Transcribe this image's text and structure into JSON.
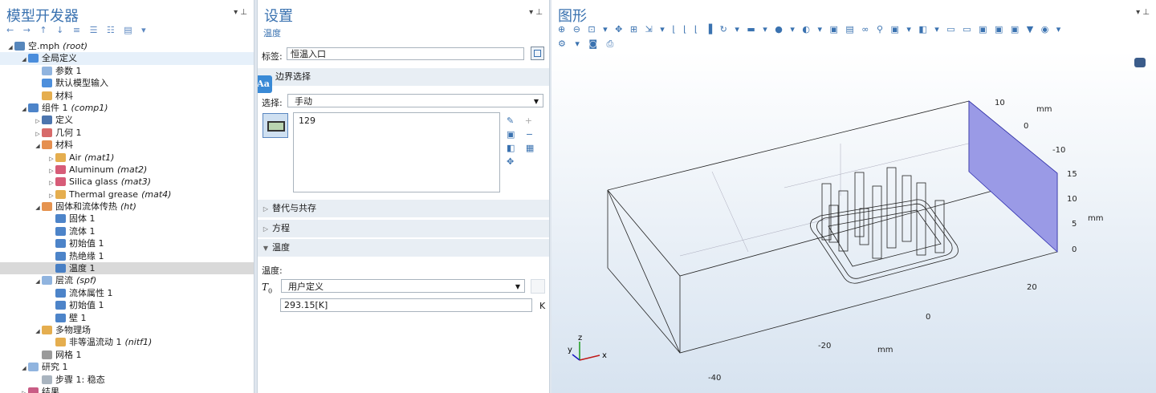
{
  "model_builder": {
    "title": "模型开发器",
    "toolbar": "← → ↑ ↓ ≡ ☰ ☷ ▤ ▾",
    "tree": [
      {
        "indent": 0,
        "tw": "◢",
        "icon": "#3a72b0",
        "label": "空.mph",
        "tag": "(root)"
      },
      {
        "indent": 1,
        "tw": "◢",
        "icon": "#2e7bd6",
        "label": "全局定义",
        "tag": "",
        "hl": true
      },
      {
        "indent": 2,
        "tw": "",
        "icon": "#7da7d9",
        "label": "参数 1",
        "tag": ""
      },
      {
        "indent": 2,
        "tw": "",
        "icon": "#2e7bd6",
        "label": "默认模型输入",
        "tag": ""
      },
      {
        "indent": 2,
        "tw": "",
        "icon": "#e0a030",
        "label": "材料",
        "tag": ""
      },
      {
        "indent": 1,
        "tw": "◢",
        "icon": "#2e6fbf",
        "label": "组件 1",
        "tag": "(comp1)"
      },
      {
        "indent": 2,
        "tw": "▷",
        "icon": "#2d5da0",
        "label": "定义",
        "tag": ""
      },
      {
        "indent": 2,
        "tw": "▷",
        "icon": "#d05050",
        "label": "几何 1",
        "tag": ""
      },
      {
        "indent": 2,
        "tw": "◢",
        "icon": "#e07b30",
        "label": "材料",
        "tag": ""
      },
      {
        "indent": 3,
        "tw": "▷",
        "icon": "#e0a030",
        "label": "Air",
        "tag": "(mat1)"
      },
      {
        "indent": 3,
        "tw": "▷",
        "icon": "#d04060",
        "label": "Aluminum",
        "tag": "(mat2)"
      },
      {
        "indent": 3,
        "tw": "▷",
        "icon": "#d04060",
        "label": "Silica glass",
        "tag": "(mat3)"
      },
      {
        "indent": 3,
        "tw": "▷",
        "icon": "#e0a030",
        "label": "Thermal grease",
        "tag": "(mat4)"
      },
      {
        "indent": 2,
        "tw": "◢",
        "icon": "#e08030",
        "label": "固体和流体传热",
        "tag": "(ht)"
      },
      {
        "indent": 3,
        "tw": "",
        "icon": "#2e6fbf",
        "label": "固体 1",
        "tag": ""
      },
      {
        "indent": 3,
        "tw": "",
        "icon": "#2e6fbf",
        "label": "流体 1",
        "tag": ""
      },
      {
        "indent": 3,
        "tw": "",
        "icon": "#2e6fbf",
        "label": "初始值 1",
        "tag": ""
      },
      {
        "indent": 3,
        "tw": "",
        "icon": "#2e6fbf",
        "label": "热绝缘 1",
        "tag": ""
      },
      {
        "indent": 3,
        "tw": "",
        "icon": "#2e6fbf",
        "label": "温度 1",
        "tag": "",
        "sel": true
      },
      {
        "indent": 2,
        "tw": "◢",
        "icon": "#7da7d9",
        "label": "层流",
        "tag": "(spf)"
      },
      {
        "indent": 3,
        "tw": "",
        "icon": "#2e6fbf",
        "label": "流体属性 1",
        "tag": ""
      },
      {
        "indent": 3,
        "tw": "",
        "icon": "#2e6fbf",
        "label": "初始值 1",
        "tag": ""
      },
      {
        "indent": 3,
        "tw": "",
        "icon": "#2e6fbf",
        "label": "壁 1",
        "tag": ""
      },
      {
        "indent": 2,
        "tw": "◢",
        "icon": "#e0a030",
        "label": "多物理场",
        "tag": ""
      },
      {
        "indent": 3,
        "tw": "",
        "icon": "#e0a030",
        "label": "非等温流动 1",
        "tag": "(nitf1)"
      },
      {
        "indent": 2,
        "tw": "",
        "icon": "#888888",
        "label": "网格 1",
        "tag": ""
      },
      {
        "indent": 1,
        "tw": "◢",
        "icon": "#7da7d9",
        "label": "研究 1",
        "tag": ""
      },
      {
        "indent": 2,
        "tw": "",
        "icon": "#9aa7b4",
        "label": "步骤 1: 稳态",
        "tag": ""
      },
      {
        "indent": 1,
        "tw": "▷",
        "icon": "#c04070",
        "label": "结果",
        "tag": ""
      }
    ]
  },
  "settings": {
    "title": "设置",
    "subtitle": "温度",
    "label_caption": "标签:",
    "label_value": "恒温入口",
    "boundary_section": "边界选择",
    "selection_caption": "选择:",
    "selection_value": "手动",
    "selection_list": "129",
    "collapsed_sections": [
      "替代与共存",
      "方程"
    ],
    "temperature_section": "温度",
    "temperature_caption": "温度:",
    "t0_symbol": "T",
    "t0_sub": "0",
    "t0_mode": "用户定义",
    "t0_value": "293.15[K]",
    "t0_unit": "K",
    "aa_badge": "Aa"
  },
  "graphics": {
    "title": "图形",
    "toolbar_row1": "⊕ ⊖ ⊡ ▾ ✥ ⊞ ⇲ ▾ ⌊ ⌊ ⌊ ▐ ↻ ▾ ▬ ▾ ● ▾ ◐ ▾ ▣ ▤ ∞ ⚲ ▣ ▾ ◧ ▾ ▭ ▭ ▣ ▣ ▣ ▼ ◉ ▾",
    "toolbar_row2": "⚙ ▾ ◙ ⎙",
    "axis_labels": {
      "top_y": [
        "10",
        "0",
        "-10"
      ],
      "top_unit": "mm",
      "right_z": [
        "15",
        "10",
        "5",
        "0"
      ],
      "right_unit": "mm",
      "bottom_y": [
        "20",
        "0"
      ],
      "bottom_x": [
        "-20",
        "-40"
      ],
      "bottom_unit": "mm"
    },
    "triad": {
      "x": "x",
      "y": "y",
      "z": "z"
    }
  },
  "colors": {
    "accent": "#3a72b0",
    "inlet_face": "#9a9ae6",
    "selection": "#d9d9d9"
  }
}
